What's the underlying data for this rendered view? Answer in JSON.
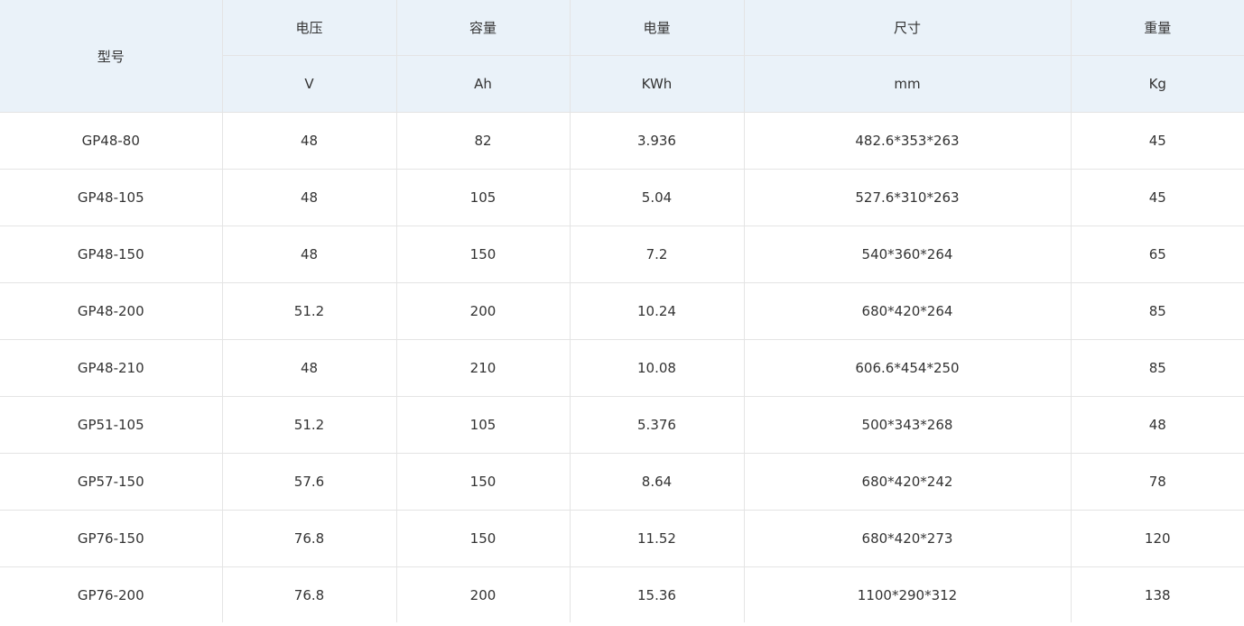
{
  "table": {
    "header": {
      "model": "型号",
      "voltage": "电压",
      "capacity": "容量",
      "energy": "电量",
      "size": "尺寸",
      "weight": "重量",
      "units": {
        "voltage": "V",
        "capacity": "Ah",
        "energy": "KWh",
        "size": "mm",
        "weight": "Kg"
      }
    },
    "rows": [
      [
        "GP48-80",
        "48",
        "82",
        "3.936",
        "482.6*353*263",
        "45"
      ],
      [
        "GP48-105",
        "48",
        "105",
        "5.04",
        "527.6*310*263",
        "45"
      ],
      [
        "GP48-150",
        "48",
        "150",
        "7.2",
        "540*360*264",
        "65"
      ],
      [
        "GP48-200",
        "51.2",
        "200",
        "10.24",
        "680*420*264",
        "85"
      ],
      [
        "GP48-210",
        "48",
        "210",
        "10.08",
        "606.6*454*250",
        "85"
      ],
      [
        "GP51-105",
        "51.2",
        "105",
        "5.376",
        "500*343*268",
        "48"
      ],
      [
        "GP57-150",
        "57.6",
        "150",
        "8.64",
        "680*420*242",
        "78"
      ],
      [
        "GP76-150",
        "76.8",
        "150",
        "11.52",
        "680*420*273",
        "120"
      ],
      [
        "GP76-200",
        "76.8",
        "200",
        "15.36",
        "1100*290*312",
        "138"
      ]
    ]
  }
}
